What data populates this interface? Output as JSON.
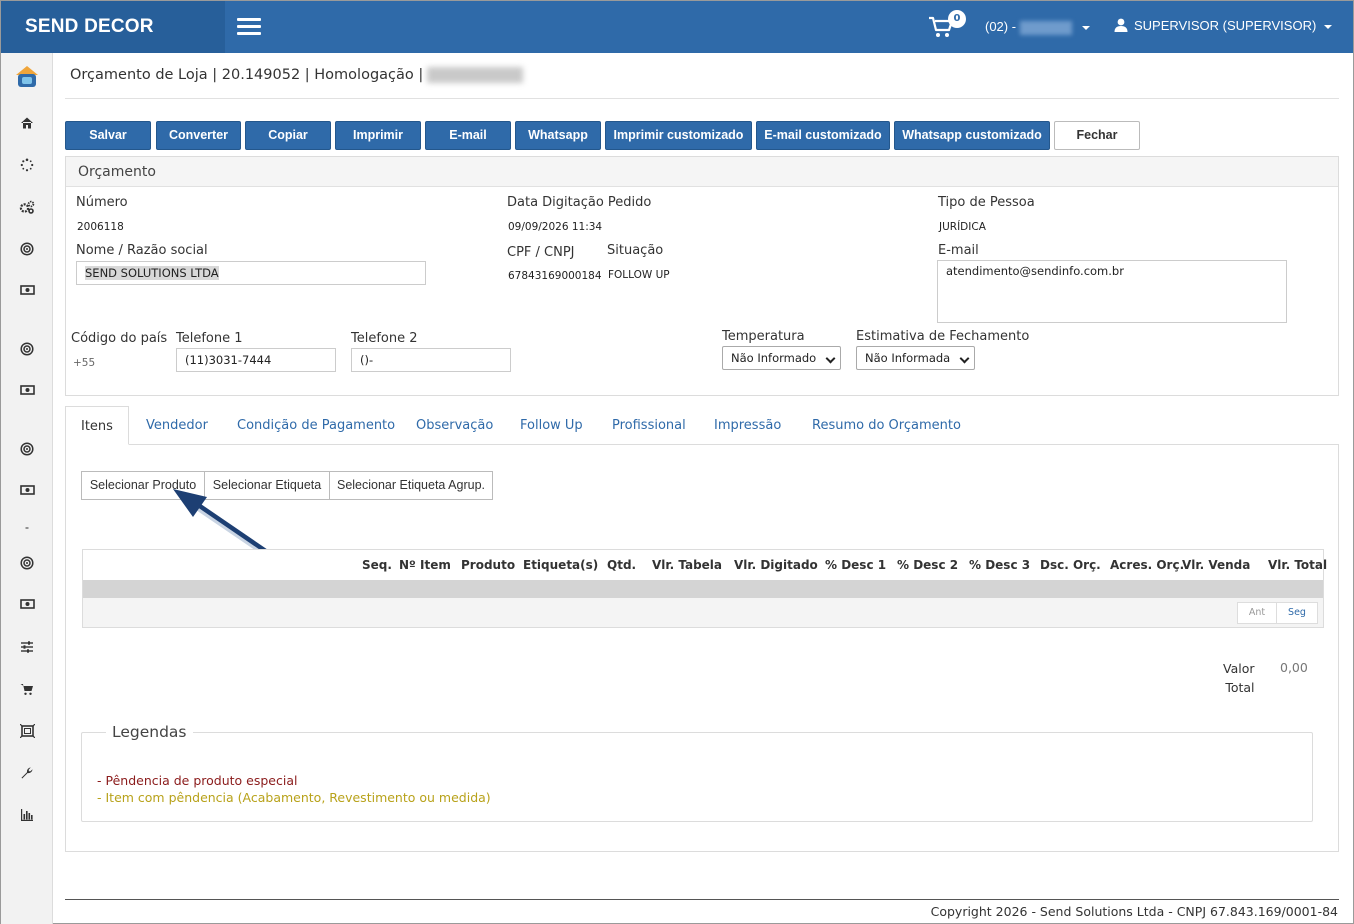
{
  "colors": {
    "primary": "#2f6aa9",
    "legend_pending_special": "#8b1c1c",
    "legend_item_pending": "#b8a21a"
  },
  "header": {
    "brand": "SEND DECOR",
    "cart_count": "0",
    "branch": "(02) -",
    "user": "SUPERVISOR (SUPERVISOR)"
  },
  "sidebar": {
    "icons": [
      "logo-icon",
      "home-icon",
      "spinner-icon",
      "cogs-icon",
      "target-icon",
      "money-icon",
      "target-icon",
      "money-icon",
      "target-icon",
      "money-icon",
      "dash-icon",
      "target-icon",
      "money-icon",
      "sliders-icon",
      "cart-icon",
      "frame-icon",
      "wrench-icon",
      "bar-chart-icon"
    ]
  },
  "page": {
    "title": "Orçamento de Loja | 20.149052 | Homologação |"
  },
  "toolbar": {
    "salvar": "Salvar",
    "converter": "Converter",
    "copiar": "Copiar",
    "imprimir": "Imprimir",
    "email": "E-mail",
    "whatsapp": "Whatsapp",
    "imprimir_custom": "Imprimir customizado",
    "email_custom": "E-mail customizado",
    "whatsapp_custom": "Whatsapp customizado",
    "fechar": "Fechar"
  },
  "form": {
    "panel_title": "Orçamento",
    "numero_label": "Número",
    "numero": "2006118",
    "data_label": "Data Digitação Pedido",
    "data": "09/09/2026 11:34",
    "tipo_label": "Tipo de Pessoa",
    "tipo": "JURÍDICA",
    "nome_label": "Nome / Razão social",
    "nome": "SEND SOLUTIONS LTDA",
    "cpf_label": "CPF / CNPJ",
    "cpf": "67843169000184",
    "situacao_label": "Situação",
    "situacao": "FOLLOW UP",
    "email_label": "E-mail",
    "email": "atendimento@sendinfo.com.br",
    "pais_label": "Código do país",
    "pais": "+55",
    "tel1_label": "Telefone 1",
    "tel1": "(11)3031-7444",
    "tel2_label": "Telefone 2",
    "tel2": "()-",
    "temp_label": "Temperatura",
    "temp": "Não Informado",
    "estimativa_label": "Estimativa de Fechamento",
    "estimativa": "Não Informada"
  },
  "tabs": {
    "itens": "Itens",
    "vendedor": "Vendedor",
    "condicao": "Condição de Pagamento",
    "observacao": "Observação",
    "followup": "Follow Up",
    "profissional": "Profissional",
    "impressao": "Impressão",
    "resumo": "Resumo do Orçamento"
  },
  "items": {
    "sel_produto": "Selecionar Produto",
    "sel_etiqueta": "Selecionar Etiqueta",
    "sel_etiqueta_agrup": "Selecionar Etiqueta Agrup.",
    "columns": [
      "Seq.",
      "Nº Item",
      "Produto",
      "Etiqueta(s)",
      "Qtd.",
      "Vlr. Tabela",
      "Vlr. Digitado",
      "% Desc 1",
      "% Desc 2",
      "% Desc 3",
      "Dsc. Orç.",
      "Acres. Orç.",
      "Vlr. Venda",
      "Vlr. Total"
    ],
    "pager_prev": "Ant",
    "pager_next": "Seg",
    "total_label_1": "Valor",
    "total_label_2": "Total",
    "total_value": "0,00"
  },
  "legend": {
    "title": "Legendas",
    "pending_special": "- Pêndencia de produto especial",
    "item_pending": "- Item com pêndencia (Acabamento, Revestimento ou medida)"
  },
  "footer": {
    "copyright": "Copyright 2026 - Send Solutions Ltda - CNPJ 67.843.169/0001-84"
  }
}
